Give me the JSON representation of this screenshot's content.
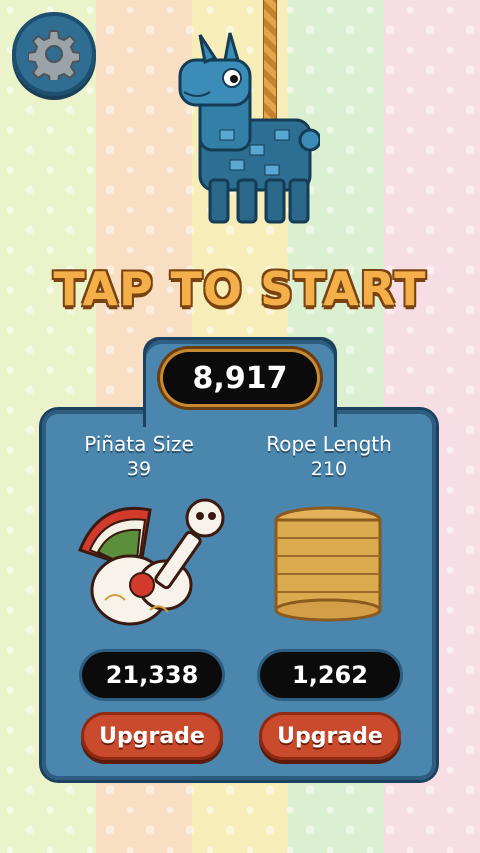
{
  "game": {
    "title": "TAP TO START",
    "coins": "8,917"
  },
  "upgrades": [
    {
      "name": "Piñata Size",
      "level": "39",
      "cost": "21,338",
      "button": "Upgrade",
      "icon": "pinata-guitar-icon"
    },
    {
      "name": "Rope Length",
      "level": "210",
      "cost": "1,262",
      "button": "Upgrade",
      "icon": "rope-coil-icon"
    }
  ],
  "icons": {
    "settings": "gear-icon",
    "character": "llama-pinata"
  },
  "colors": {
    "panel": "#4a86ad",
    "title": "#f3b04a",
    "button": "#c94a2c",
    "stripes": [
      "#e9f2c3",
      "#f7d7b9",
      "#f5e7a9",
      "#cfeecf",
      "#f6d9e3"
    ]
  }
}
